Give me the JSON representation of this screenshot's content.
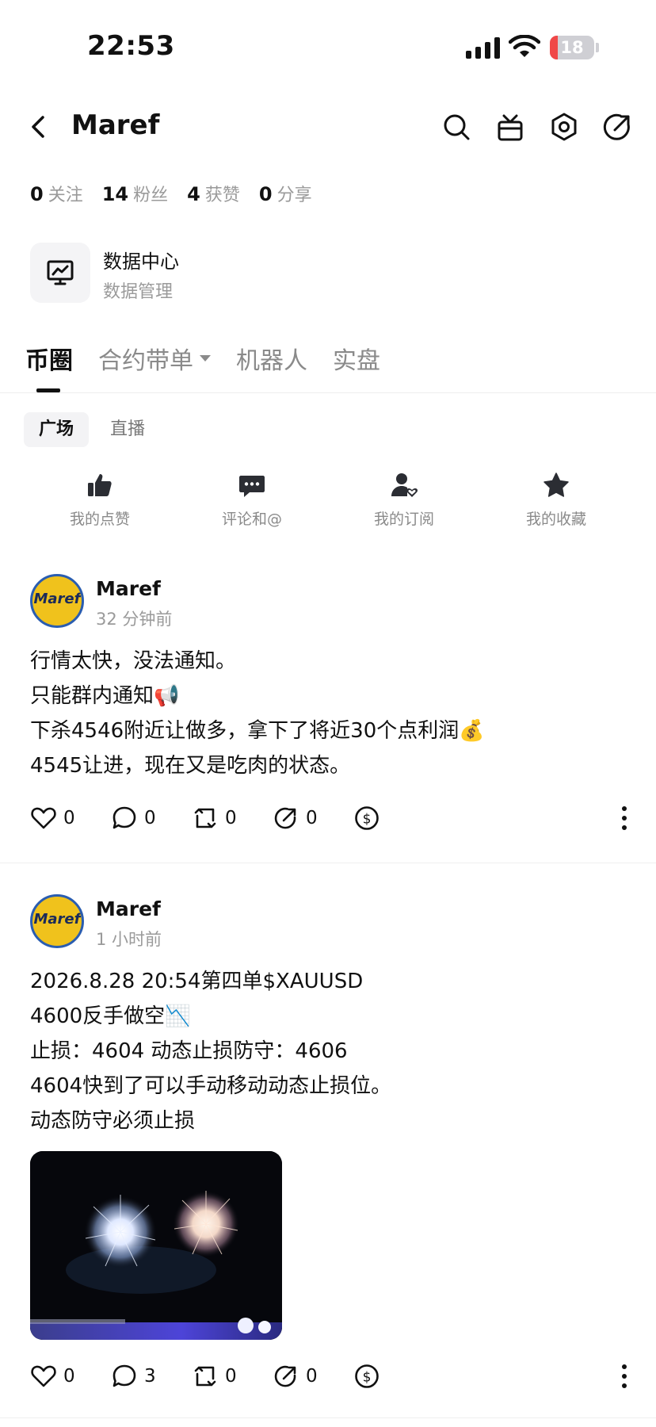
{
  "status_bar": {
    "time": "22:53",
    "battery_level": "18",
    "battery_fraction": 0.18
  },
  "header": {
    "title": "Maref"
  },
  "stats": [
    {
      "count": "0",
      "label": "关注"
    },
    {
      "count": "14",
      "label": "粉丝"
    },
    {
      "count": "4",
      "label": "获赞"
    },
    {
      "count": "0",
      "label": "分享"
    }
  ],
  "data_center": {
    "title": "数据中心",
    "subtitle": "数据管理"
  },
  "tabs": [
    {
      "label": "币圈"
    },
    {
      "label": "合约带单"
    },
    {
      "label": "机器人"
    },
    {
      "label": "实盘"
    }
  ],
  "sub_tabs": [
    {
      "label": "广场"
    },
    {
      "label": "直播"
    }
  ],
  "quick_actions": [
    {
      "label": "我的点赞",
      "icon": "thumbs-up-icon"
    },
    {
      "label": "评论和@",
      "icon": "comment-icon"
    },
    {
      "label": "我的订阅",
      "icon": "subscription-icon"
    },
    {
      "label": "我的收藏",
      "icon": "star-icon"
    }
  ],
  "posts": [
    {
      "author": "Maref",
      "time": "32 分钟前",
      "lines": [
        "行情太快，没法通知。",
        "只能群内通知📢",
        "下杀4546附近让做多，拿下了将近30个点利润💰",
        "4545让进，现在又是吃肉的状态。"
      ],
      "likes": "0",
      "comments": "0",
      "reposts": "0",
      "shares": "0"
    },
    {
      "author": "Maref",
      "time": "1 小时前",
      "lines": [
        "2026.8.28 20:54第四单$XAUUSD",
        "4600反手做空📉",
        "止损：4604  动态止损防守：4606",
        "4604快到了可以手动移动动态止损位。",
        "动态防守必须止损"
      ],
      "likes": "0",
      "comments": "3",
      "reposts": "0",
      "shares": "0"
    }
  ],
  "avatar_text": "Maref"
}
